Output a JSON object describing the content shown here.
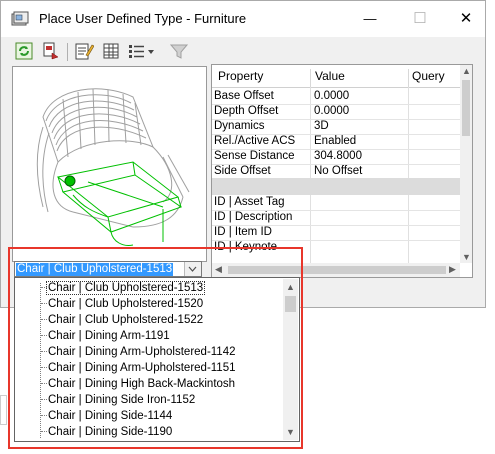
{
  "window": {
    "title": "Place User Defined Type - Furniture",
    "minimize_glyph": "—",
    "maximize_glyph": "☐",
    "close_glyph": "✕"
  },
  "toolbar": {
    "icons": [
      "refresh-icon",
      "place-icon",
      "edit-properties-icon",
      "grid-view-icon",
      "list-view-icon",
      "filter-icon"
    ]
  },
  "preview": {
    "accent_color": "#00c000",
    "wire_color": "#a0a0a0"
  },
  "combo": {
    "value": "Chair | Club Upholstered-1513"
  },
  "grid": {
    "headers": [
      "Property",
      "Value",
      "Query"
    ],
    "rows": [
      {
        "property": "Base Offset",
        "value": "0.0000"
      },
      {
        "property": "Depth Offset",
        "value": "0.0000"
      },
      {
        "property": "Dynamics",
        "value": "3D"
      },
      {
        "property": "Rel./Active ACS",
        "value": "Enabled"
      },
      {
        "property": "Sense Distance",
        "value": "304.8000"
      },
      {
        "property": "Side Offset",
        "value": "No Offset"
      }
    ],
    "id_rows": [
      {
        "property": "ID | Asset Tag",
        "value": ""
      },
      {
        "property": "ID | Description",
        "value": ""
      },
      {
        "property": "ID | Item ID",
        "value": ""
      },
      {
        "property": "ID | Keynote",
        "value": ""
      }
    ]
  },
  "dropdown": {
    "items": [
      "Chair | Club Upholstered-1513",
      "Chair | Club Upholstered-1520",
      "Chair | Club Upholstered-1522",
      "Chair | Dining Arm-1191",
      "Chair | Dining Arm-Upholstered-1142",
      "Chair | Dining Arm-Upholstered-1151",
      "Chair | Dining High Back-Mackintosh",
      "Chair | Dining Side Iron-1152",
      "Chair | Dining Side-1144",
      "Chair | Dining Side-1190"
    ],
    "selected_index": 0
  },
  "colors": {
    "selection": "#3399ff",
    "highlight_border": "#e8362b"
  }
}
